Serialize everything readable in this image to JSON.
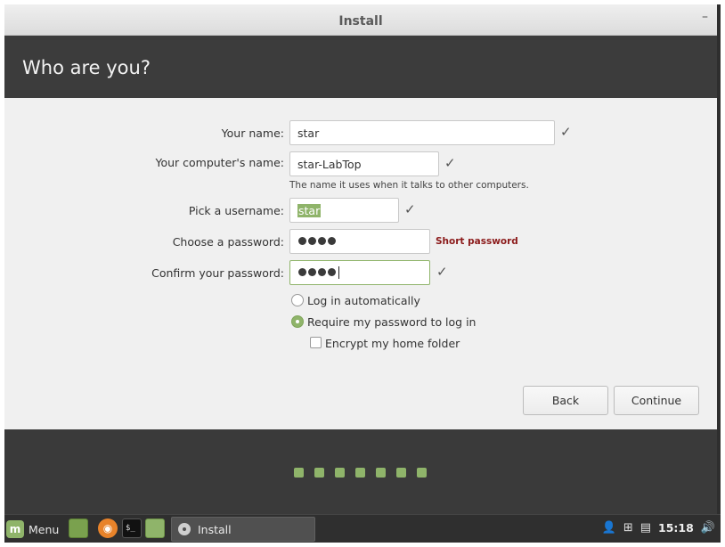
{
  "window": {
    "title": "Install",
    "minimize_glyph": "–"
  },
  "header": {
    "title": "Who are you?"
  },
  "form": {
    "name": {
      "label": "Your name:",
      "value": "star"
    },
    "computer": {
      "label": "Your computer's name:",
      "value": "star-LabTop",
      "hint": "The name it uses when it talks to other computers."
    },
    "username": {
      "label": "Pick a username:",
      "value": "star"
    },
    "password": {
      "label": "Choose a password:",
      "strength": "Short password"
    },
    "confirm": {
      "label": "Confirm your password:"
    },
    "check_glyph": "✓",
    "options": {
      "auto_login": {
        "label": "Log in automatically",
        "selected": false
      },
      "require_password": {
        "label": "Require my password to log in",
        "selected": true
      },
      "encrypt_home": {
        "label": "Encrypt my home folder",
        "checked": false
      }
    }
  },
  "buttons": {
    "back": "Back",
    "continue": "Continue"
  },
  "progress": {
    "total_steps": 7
  },
  "taskbar": {
    "menu_label": "Menu",
    "task_label": "Install",
    "clock": "15:18",
    "icons": [
      "mint-logo-icon",
      "show-desktop-icon",
      "firefox-icon",
      "terminal-icon",
      "files-icon",
      "user-icon",
      "network-icon",
      "clipboard-icon",
      "volume-icon"
    ]
  },
  "colors": {
    "accent": "#8fb46a",
    "warning": "#8b1a1a",
    "header_bg": "#3c3c3c",
    "content_bg": "#f0f0f0"
  }
}
